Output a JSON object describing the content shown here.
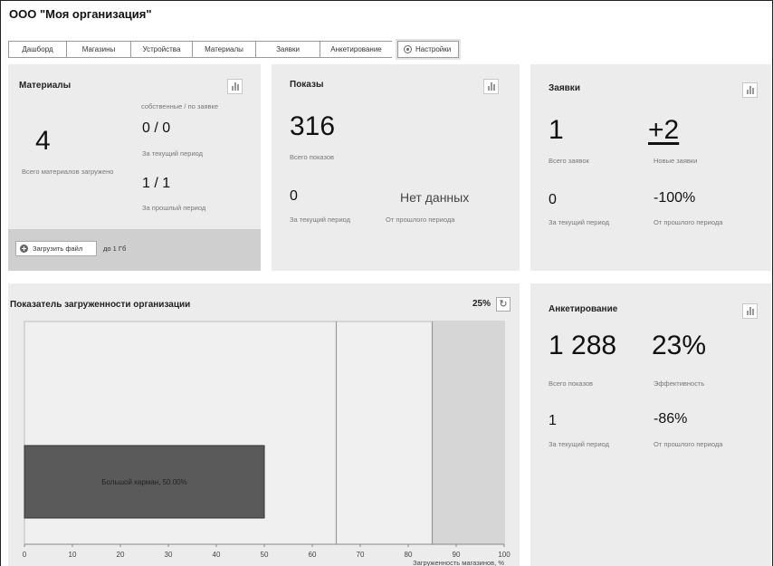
{
  "org": {
    "title": "ООО \"Моя организация\""
  },
  "tabs": [
    {
      "label": "Дашборд"
    },
    {
      "label": "Магазины"
    },
    {
      "label": "Устройства"
    },
    {
      "label": "Материалы"
    },
    {
      "label": "Заявки"
    },
    {
      "label": "Анкетирование"
    }
  ],
  "settings_tab": {
    "label": "Настройки",
    "icon": "gear-icon"
  },
  "materials": {
    "title": "Материалы",
    "total": "4",
    "total_caption": "Всего материалов загружено",
    "header_caption": "собственные / по заявке",
    "current_value": "0 / 0",
    "current_caption": "За текущий период",
    "prev_value": "1 / 1",
    "prev_caption": "За прошлый период",
    "upload_label": "Загрузить файл",
    "upload_limit": "до 1 Гб"
  },
  "shows": {
    "title": "Показы",
    "total": "316",
    "total_caption": "Всего показов",
    "current_value": "0",
    "current_caption": "За текущий период",
    "prev_value": "Нет данных",
    "prev_caption": "От прошлого периода"
  },
  "requests": {
    "title": "Заявки",
    "total": "1",
    "total_caption": "Всего заявок",
    "new_value": "+2",
    "new_caption": "Новые заявки",
    "current_value": "0",
    "current_caption": "За текущий период",
    "prev_value": "-100%",
    "prev_caption": "От прошлого периода"
  },
  "surveys": {
    "title": "Анкетирование",
    "total": "1 288",
    "total_caption": "Всего показов",
    "efficiency": "23%",
    "efficiency_caption": "Эффективность",
    "current_value": "1",
    "current_caption": "За текущий период",
    "prev_value": "-86%",
    "prev_caption": "От прошлого периода"
  },
  "load": {
    "title": "Показатель загруженности организации",
    "percent": "25%",
    "refresh_icon": "refresh-icon"
  },
  "chart_data": {
    "type": "bar",
    "orientation": "horizontal",
    "categories": [
      "Большой карман"
    ],
    "values": [
      50
    ],
    "bar_labels": [
      "Большой карман, 50.00%"
    ],
    "xlabel": "Загруженность магазинов, %",
    "ylabel": "",
    "xlim": [
      0,
      100
    ],
    "xticks": [
      0,
      10,
      20,
      30,
      40,
      50,
      60,
      70,
      80,
      90,
      100
    ],
    "reference_lines": [
      65,
      85
    ],
    "band": [
      85,
      100
    ],
    "colors": {
      "bar": "#5a5a5a",
      "background": "#f0f0f0",
      "band": "#d6d6d6"
    },
    "grid": false
  }
}
